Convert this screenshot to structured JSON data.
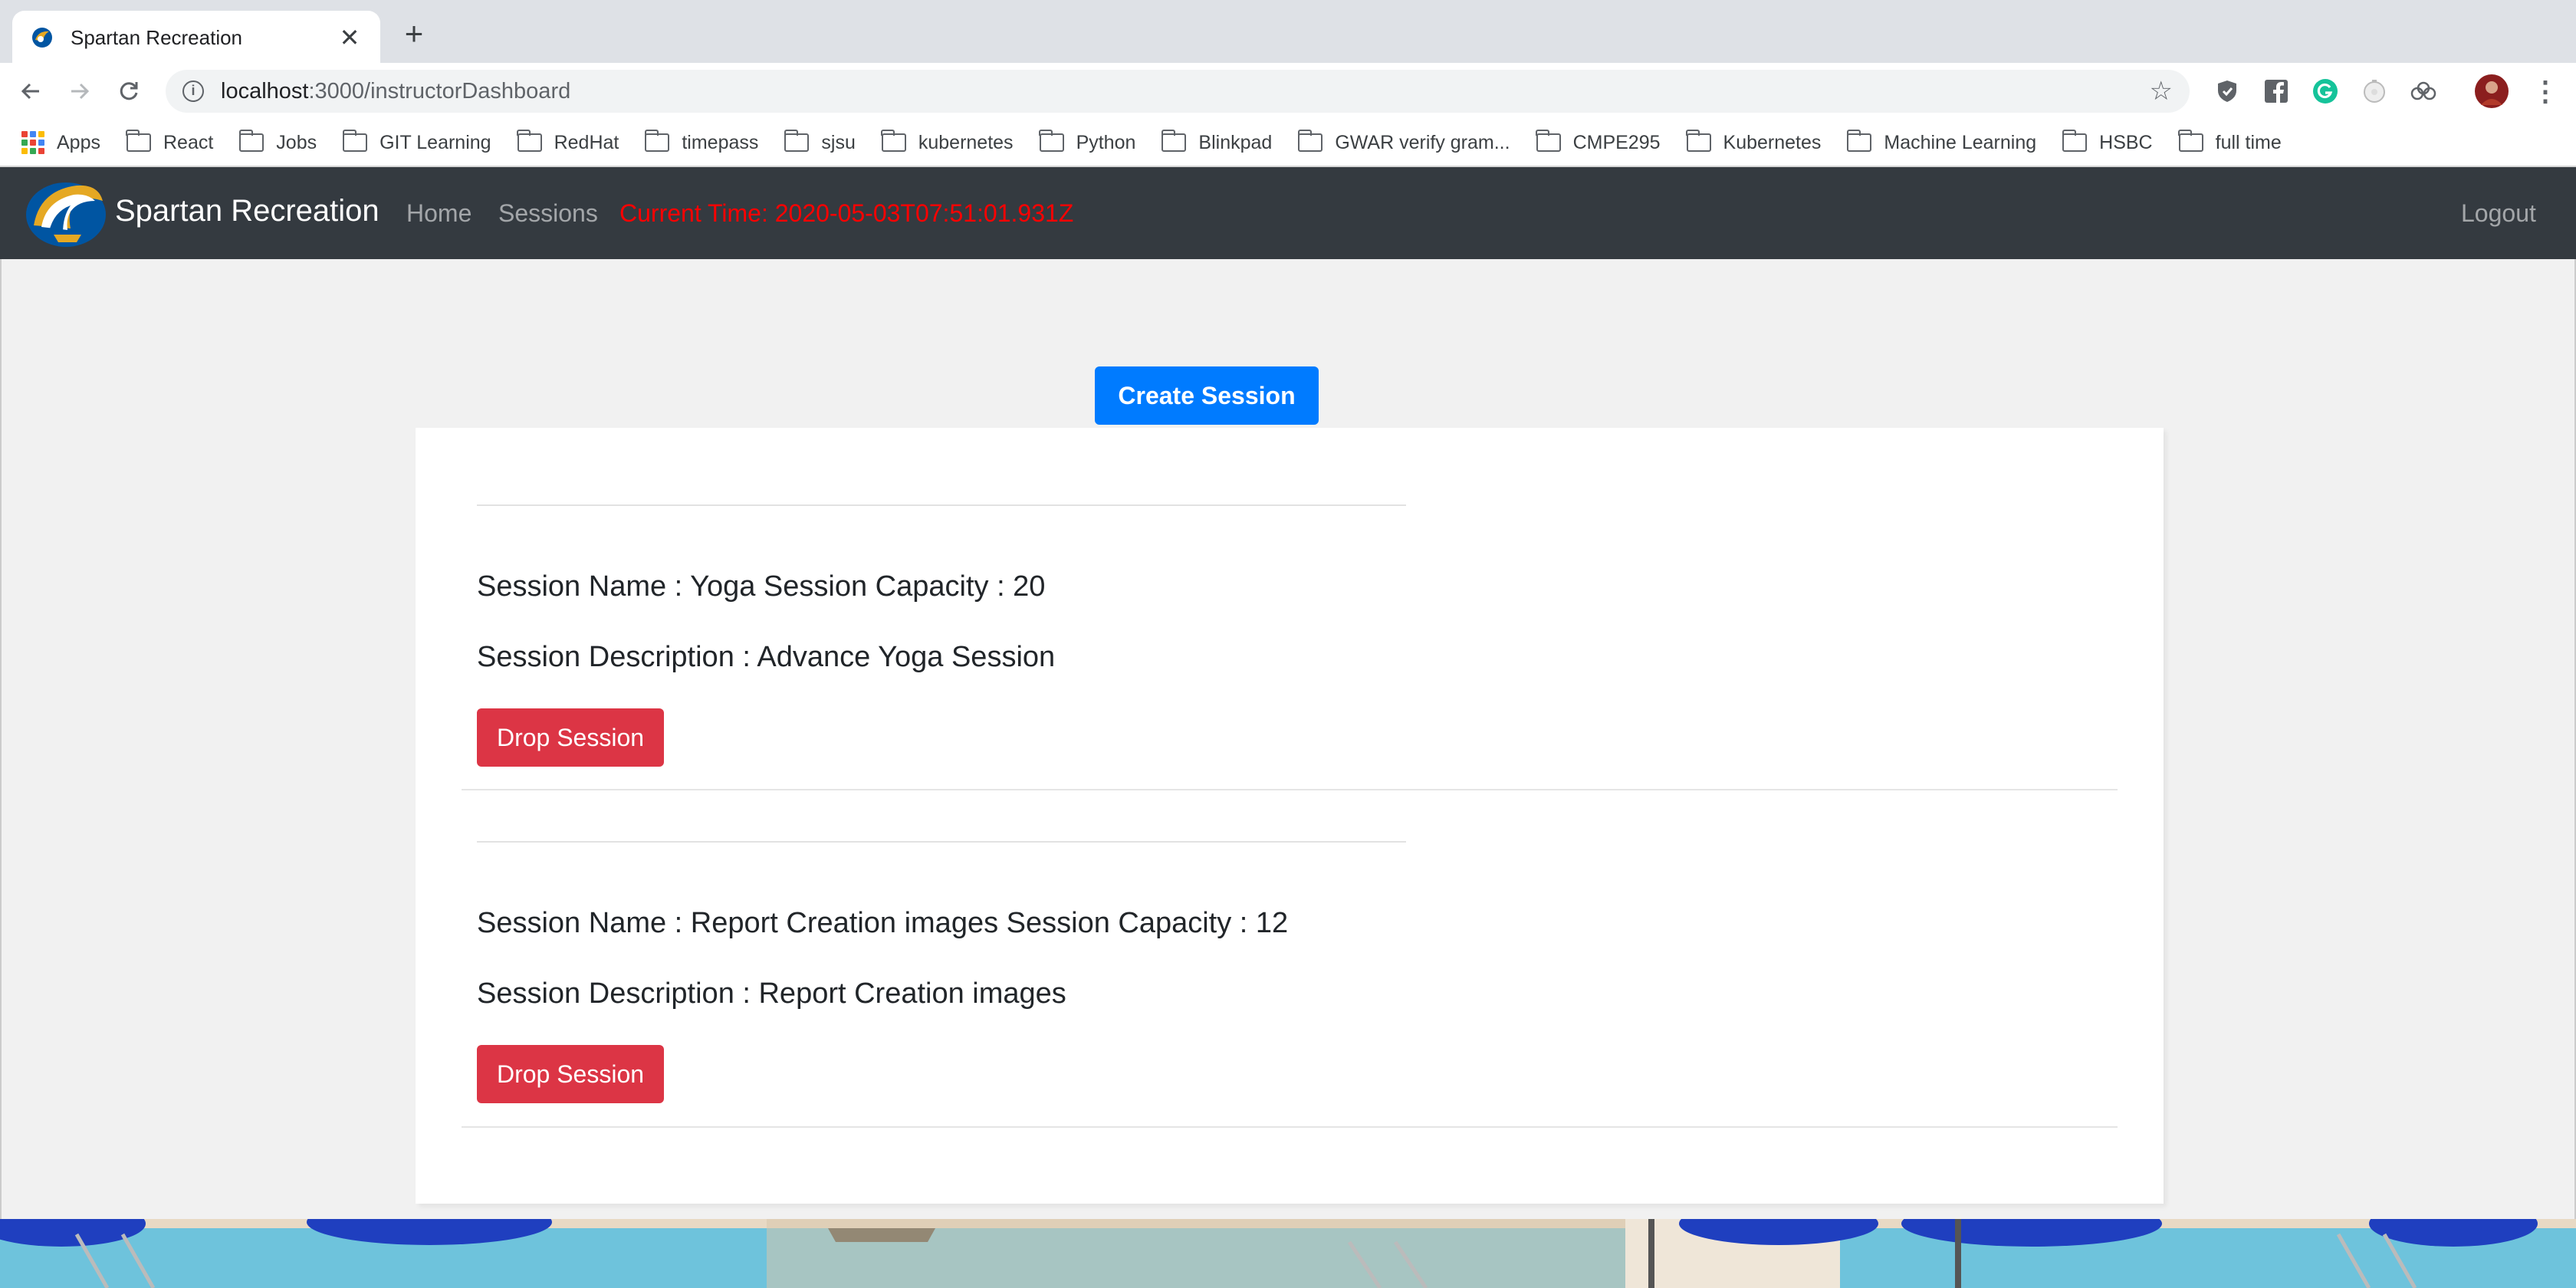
{
  "browser": {
    "tab_title": "Spartan Recreation",
    "tab_close": "✕",
    "new_tab": "+",
    "url_host": "localhost",
    "url_path": ":3000/instructorDashboard",
    "bookmarks": [
      {
        "label": "Apps",
        "icon": "apps-grid-icon"
      },
      {
        "label": "React",
        "icon": "folder-icon"
      },
      {
        "label": "Jobs",
        "icon": "folder-icon"
      },
      {
        "label": "GIT Learning",
        "icon": "folder-icon"
      },
      {
        "label": "RedHat",
        "icon": "folder-icon"
      },
      {
        "label": "timepass",
        "icon": "folder-icon"
      },
      {
        "label": "sjsu",
        "icon": "folder-icon"
      },
      {
        "label": "kubernetes",
        "icon": "folder-icon"
      },
      {
        "label": "Python",
        "icon": "folder-icon"
      },
      {
        "label": "Blinkpad",
        "icon": "folder-icon"
      },
      {
        "label": "GWAR verify gram...",
        "icon": "folder-icon"
      },
      {
        "label": "CMPE295",
        "icon": "folder-icon"
      },
      {
        "label": "Kubernetes",
        "icon": "folder-icon"
      },
      {
        "label": "Machine Learning",
        "icon": "folder-icon"
      },
      {
        "label": "HSBC",
        "icon": "folder-icon"
      },
      {
        "label": "full time",
        "icon": "folder-icon"
      }
    ]
  },
  "navbar": {
    "brand": "Spartan Recreation",
    "home": "Home",
    "sessions": "Sessions",
    "current_time": "Current Time: 2020-05-03T07:51:01.931Z",
    "logout": "Logout"
  },
  "main": {
    "create_button": "Create Session",
    "sessions": [
      {
        "name_line": "Session Name : Yoga Session Capacity : 20",
        "description_line": "Session Description : Advance Yoga Session",
        "drop_label": "Drop Session"
      },
      {
        "name_line": "Session Name : Report Creation images Session Capacity : 12",
        "description_line": "Session Description : Report Creation images",
        "drop_label": "Drop Session"
      }
    ]
  },
  "colors": {
    "navbar_bg": "#343a40",
    "primary": "#007bff",
    "danger": "#dc3545",
    "time_text": "#ff0000"
  }
}
